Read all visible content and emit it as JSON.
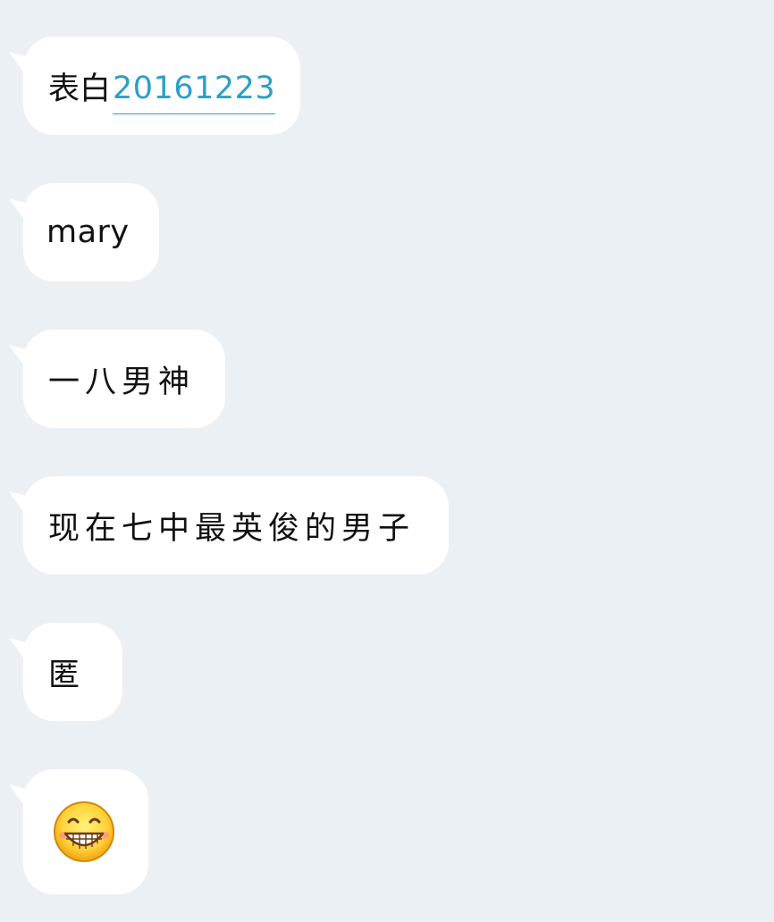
{
  "messages": [
    {
      "prefix": "表白",
      "link": "20161223"
    },
    {
      "text": "mary"
    },
    {
      "text": "一八男神"
    },
    {
      "text": "现在七中最英俊的男子"
    },
    {
      "text": "匿"
    },
    {
      "emoji": "grinning-face-emoji"
    }
  ]
}
